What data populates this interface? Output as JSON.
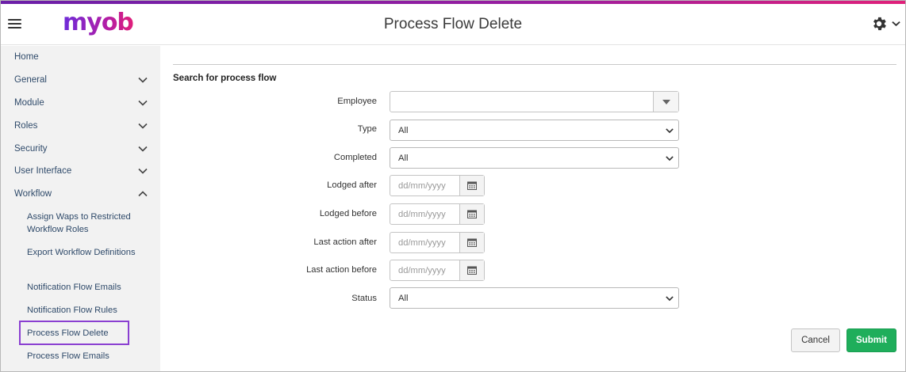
{
  "header": {
    "logo_text": "myob",
    "title": "Process Flow Delete",
    "icons": {
      "menu": "hamburger-menu-icon",
      "settings": "gear-icon",
      "settings_dropdown": "chevron-down-icon"
    }
  },
  "colors": {
    "brand_gradient_start": "#6b1fa8",
    "brand_gradient_end": "#e0207a",
    "active_outline": "#8a3fd1",
    "submit_green": "#1fae5b"
  },
  "sidebar": {
    "items": [
      {
        "label": "Home"
      },
      {
        "label": "General"
      },
      {
        "label": "Module"
      },
      {
        "label": "Roles"
      },
      {
        "label": "Security"
      },
      {
        "label": "User Interface"
      },
      {
        "label": "Workflow"
      }
    ],
    "workflow_children": [
      {
        "label": "Assign Waps to Restricted Workflow Roles"
      },
      {
        "label": "Export Workflow Definitions"
      },
      {
        "label": "Notification Flow Emails"
      },
      {
        "label": "Notification Flow Rules"
      },
      {
        "label": "Process Flow Delete",
        "active": true
      },
      {
        "label": "Process Flow Emails"
      }
    ]
  },
  "form": {
    "section_title": "Search for process flow",
    "employee": {
      "label": "Employee",
      "value": ""
    },
    "type": {
      "label": "Type",
      "value": "All"
    },
    "completed": {
      "label": "Completed",
      "value": "All"
    },
    "lodged_after": {
      "label": "Lodged after",
      "placeholder": "dd/mm/yyyy"
    },
    "lodged_before": {
      "label": "Lodged before",
      "placeholder": "dd/mm/yyyy"
    },
    "last_action_after": {
      "label": "Last action after",
      "placeholder": "dd/mm/yyyy"
    },
    "last_action_before": {
      "label": "Last action before",
      "placeholder": "dd/mm/yyyy"
    },
    "status": {
      "label": "Status",
      "value": "All"
    }
  },
  "actions": {
    "cancel_label": "Cancel",
    "submit_label": "Submit"
  }
}
